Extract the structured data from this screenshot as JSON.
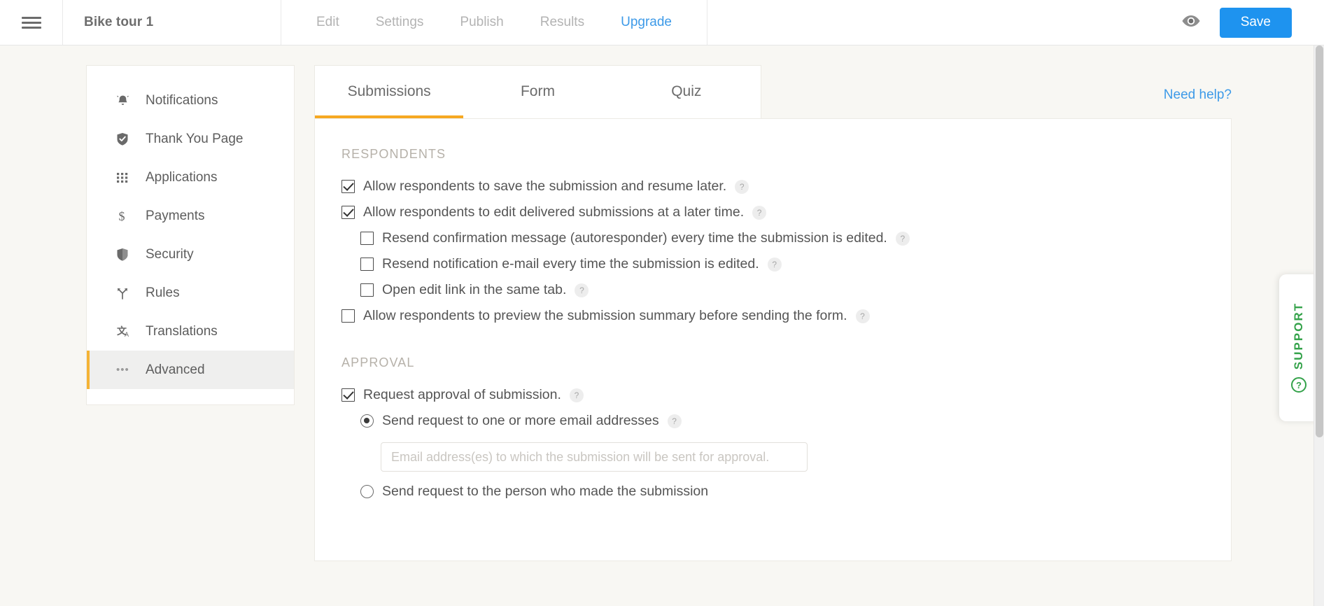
{
  "topbar": {
    "menu_icon": "hamburger-menu-icon",
    "form_title": "Bike tour 1",
    "nav": [
      {
        "label": "Edit",
        "active": false
      },
      {
        "label": "Settings",
        "active": false
      },
      {
        "label": "Publish",
        "active": false
      },
      {
        "label": "Results",
        "active": false
      },
      {
        "label": "Upgrade",
        "active": true
      }
    ],
    "preview_icon": "eye-icon",
    "save_label": "Save",
    "accent_blue": "#1e93ef",
    "upgrade_color": "#3d9ae8"
  },
  "sidebar": {
    "items": [
      {
        "label": "Notifications",
        "icon": "bell-icon",
        "active": false
      },
      {
        "label": "Thank You Page",
        "icon": "shield-check-icon",
        "active": false
      },
      {
        "label": "Applications",
        "icon": "grid-dots-icon",
        "active": false
      },
      {
        "label": "Payments",
        "icon": "dollar-icon",
        "active": false
      },
      {
        "label": "Security",
        "icon": "shield-icon",
        "active": false
      },
      {
        "label": "Rules",
        "icon": "branch-icon",
        "active": false
      },
      {
        "label": "Translations",
        "icon": "translate-icon",
        "active": false
      },
      {
        "label": "Advanced",
        "icon": "ellipsis-icon",
        "active": true
      }
    ],
    "active_marker_color": "#f5b335"
  },
  "main": {
    "tabs": [
      {
        "label": "Submissions",
        "active": true
      },
      {
        "label": "Form",
        "active": false
      },
      {
        "label": "Quiz",
        "active": false
      }
    ],
    "active_tab_color": "#f6a821",
    "need_help_label": "Need help?",
    "sections": [
      {
        "title": "RESPONDENTS",
        "options": [
          {
            "type": "checkbox",
            "checked": true,
            "indent": 0,
            "label": "Allow respondents to save the submission and resume later.",
            "help": "?"
          },
          {
            "type": "checkbox",
            "checked": true,
            "indent": 0,
            "label": "Allow respondents to edit delivered submissions at a later time.",
            "help": "?"
          },
          {
            "type": "checkbox",
            "checked": false,
            "indent": 1,
            "label": "Resend confirmation message (autoresponder) every time the submission is edited.",
            "help": "?"
          },
          {
            "type": "checkbox",
            "checked": false,
            "indent": 1,
            "label": "Resend notification e-mail every time the submission is edited.",
            "help": "?"
          },
          {
            "type": "checkbox",
            "checked": false,
            "indent": 1,
            "label": "Open edit link in the same tab.",
            "help": "?"
          },
          {
            "type": "checkbox",
            "checked": false,
            "indent": 0,
            "label": "Allow respondents to preview the submission summary before sending the form.",
            "help": "?"
          }
        ]
      },
      {
        "title": "APPROVAL",
        "options": [
          {
            "type": "checkbox",
            "checked": true,
            "indent": 0,
            "label": "Request approval of submission.",
            "help": "?"
          },
          {
            "type": "radio",
            "checked": true,
            "indent": 1,
            "label": "Send request to one or more email addresses",
            "help": "?"
          },
          {
            "type": "input",
            "value": "",
            "placeholder": "Email address(es) to which the submission will be sent for approval."
          },
          {
            "type": "radio",
            "checked": false,
            "indent": 1,
            "label": "Send request to the person who made the submission",
            "help": ""
          }
        ]
      }
    ]
  },
  "support": {
    "label": "SUPPORT",
    "icon": "question-circle-icon",
    "color": "#34a24a"
  }
}
